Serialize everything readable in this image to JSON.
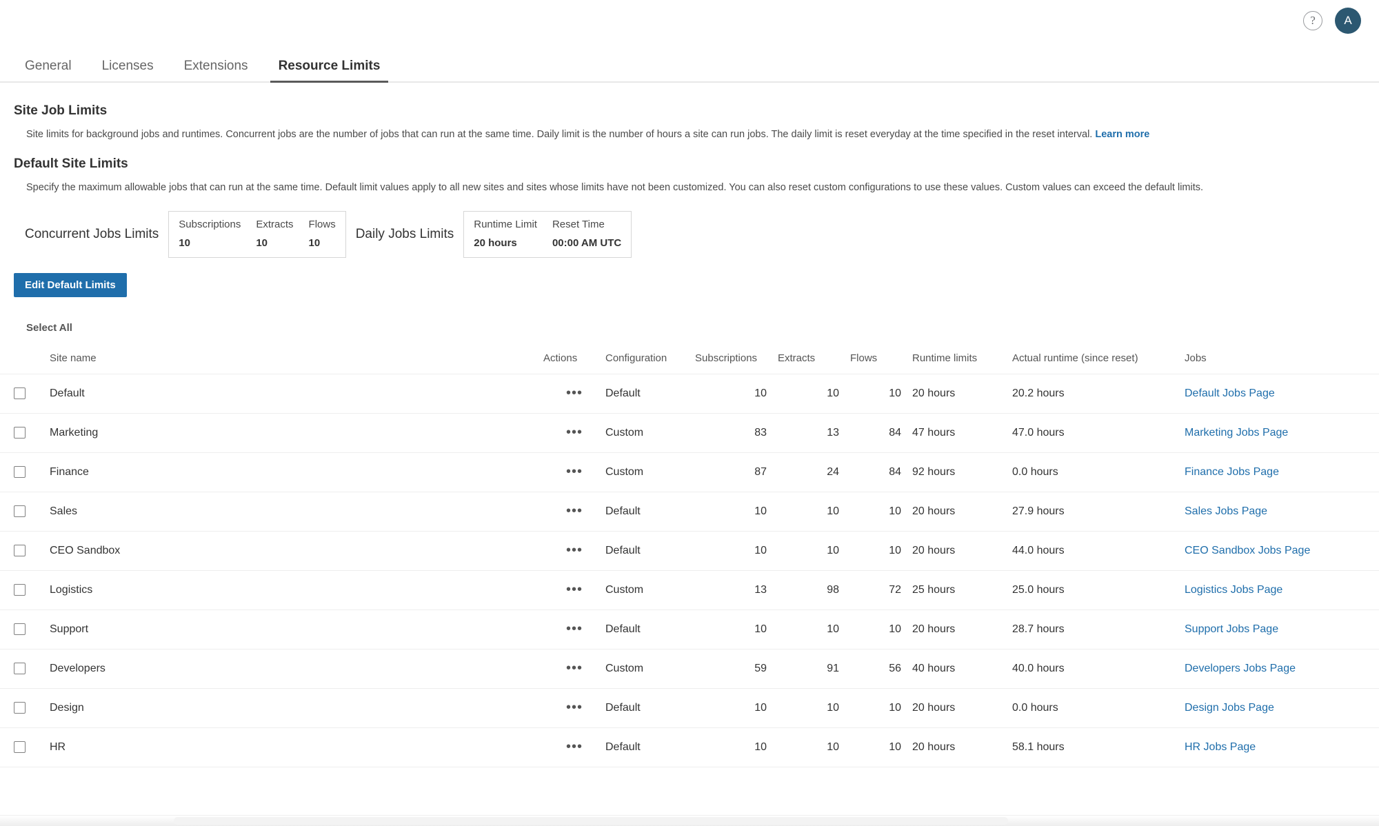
{
  "topbar": {
    "help_icon": "question-mark-circle",
    "avatar_initial": "A",
    "avatar_color": "#2c5871"
  },
  "tabs": [
    {
      "label": "General",
      "active": false
    },
    {
      "label": "Licenses",
      "active": false
    },
    {
      "label": "Extensions",
      "active": false
    },
    {
      "label": "Resource Limits",
      "active": true
    }
  ],
  "site_job_limits": {
    "title": "Site Job Limits",
    "description": "Site limits for background jobs and runtimes. Concurrent jobs are the number of jobs that can run at the same time. Daily limit is the number of hours a site can run jobs. The daily limit is reset everyday at the time specified in the reset interval.",
    "learn_more": "Learn more"
  },
  "default_site_limits": {
    "title": "Default Site Limits",
    "description": "Specify the maximum allowable jobs that can run at the same time. Default limit values apply to all new sites and sites whose limits have not been customized. You can also reset custom configurations to use these values. Custom values can exceed the default limits.",
    "concurrent_label": "Concurrent Jobs Limits",
    "concurrent": [
      {
        "head": "Subscriptions",
        "value": "10"
      },
      {
        "head": "Extracts",
        "value": "10"
      },
      {
        "head": "Flows",
        "value": "10"
      }
    ],
    "daily_label": "Daily Jobs Limits",
    "daily": [
      {
        "head": "Runtime Limit",
        "value": "20 hours"
      },
      {
        "head": "Reset Time",
        "value": "00:00 AM UTC"
      }
    ],
    "edit_button": "Edit Default Limits",
    "button_color": "#1f6eab"
  },
  "table": {
    "select_all": "Select All",
    "columns": [
      "Site name",
      "Actions",
      "Configuration",
      "Subscriptions",
      "Extracts",
      "Flows",
      "Runtime limits",
      "Actual runtime (since reset)",
      "Jobs"
    ],
    "actions_glyph": "•••",
    "rows": [
      {
        "checked": false,
        "site": "Default",
        "config": "Default",
        "subscriptions": "10",
        "extracts": "10",
        "flows": "10",
        "runtime_limits": "20 hours",
        "actual_runtime": "20.2 hours",
        "jobs_link": "Default Jobs Page"
      },
      {
        "checked": false,
        "site": "Marketing",
        "config": "Custom",
        "subscriptions": "83",
        "extracts": "13",
        "flows": "84",
        "runtime_limits": "47 hours",
        "actual_runtime": "47.0 hours",
        "jobs_link": "Marketing Jobs Page"
      },
      {
        "checked": false,
        "site": "Finance",
        "config": "Custom",
        "subscriptions": "87",
        "extracts": "24",
        "flows": "84",
        "runtime_limits": "92 hours",
        "actual_runtime": "0.0 hours",
        "jobs_link": "Finance Jobs Page"
      },
      {
        "checked": false,
        "site": "Sales",
        "config": "Default",
        "subscriptions": "10",
        "extracts": "10",
        "flows": "10",
        "runtime_limits": "20 hours",
        "actual_runtime": "27.9 hours",
        "jobs_link": "Sales Jobs Page"
      },
      {
        "checked": false,
        "site": "CEO Sandbox",
        "config": "Default",
        "subscriptions": "10",
        "extracts": "10",
        "flows": "10",
        "runtime_limits": "20 hours",
        "actual_runtime": "44.0 hours",
        "jobs_link": "CEO Sandbox Jobs Page"
      },
      {
        "checked": false,
        "site": "Logistics",
        "config": "Custom",
        "subscriptions": "13",
        "extracts": "98",
        "flows": "72",
        "runtime_limits": "25 hours",
        "actual_runtime": "25.0 hours",
        "jobs_link": "Logistics Jobs Page"
      },
      {
        "checked": false,
        "site": "Support",
        "config": "Default",
        "subscriptions": "10",
        "extracts": "10",
        "flows": "10",
        "runtime_limits": "20 hours",
        "actual_runtime": "28.7 hours",
        "jobs_link": "Support Jobs Page"
      },
      {
        "checked": false,
        "site": "Developers",
        "config": "Custom",
        "subscriptions": "59",
        "extracts": "91",
        "flows": "56",
        "runtime_limits": "40 hours",
        "actual_runtime": "40.0 hours",
        "jobs_link": "Developers Jobs Page"
      },
      {
        "checked": false,
        "site": "Design",
        "config": "Default",
        "subscriptions": "10",
        "extracts": "10",
        "flows": "10",
        "runtime_limits": "20 hours",
        "actual_runtime": "0.0 hours",
        "jobs_link": "Design Jobs Page"
      },
      {
        "checked": false,
        "site": "HR",
        "config": "Default",
        "subscriptions": "10",
        "extracts": "10",
        "flows": "10",
        "runtime_limits": "20 hours",
        "actual_runtime": "58.1 hours",
        "jobs_link": "HR Jobs Page"
      }
    ]
  },
  "colors": {
    "link": "#1f6eab",
    "accent": "#1f6eab"
  }
}
